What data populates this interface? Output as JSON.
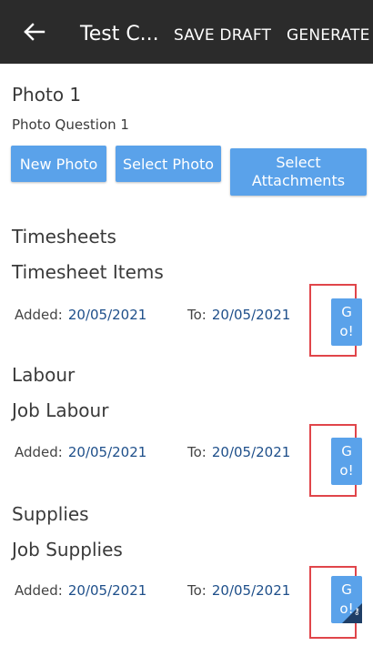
{
  "appbar": {
    "back_icon": "arrow-left-icon",
    "title": "Test C...",
    "save_draft": "SAVE DRAFT",
    "generate": "GENERATE",
    "background": "#2b2b2b"
  },
  "photo": {
    "heading": "Photo 1",
    "question": "Photo Question 1",
    "buttons": {
      "new_photo": "New Photo",
      "select_photo": "Select Photo",
      "select_attachments": "Select Attachments"
    }
  },
  "sections": [
    {
      "heading": "Timesheets",
      "subheading": "Timesheet Items",
      "added_label": "Added:",
      "added_value": "20/05/2021",
      "to_label": "To:",
      "to_value": "20/05/2021",
      "go_line1": "G",
      "go_line2": "o!"
    },
    {
      "heading": "Labour",
      "subheading": "Job Labour",
      "added_label": "Added:",
      "added_value": "20/05/2021",
      "to_label": "To:",
      "to_value": "20/05/2021",
      "go_line1": "G",
      "go_line2": "o!"
    },
    {
      "heading": "Supplies",
      "subheading": "Job Supplies",
      "added_label": "Added:",
      "added_value": "20/05/2021",
      "to_label": "To:",
      "to_value": "20/05/2021",
      "go_line1": "G",
      "go_line2": "o!"
    }
  ],
  "colors": {
    "button": "#5aa2ea",
    "highlight_frame": "#e0454a",
    "date_value": "#1e4f8a",
    "corner_badge": "#1f3e66"
  }
}
